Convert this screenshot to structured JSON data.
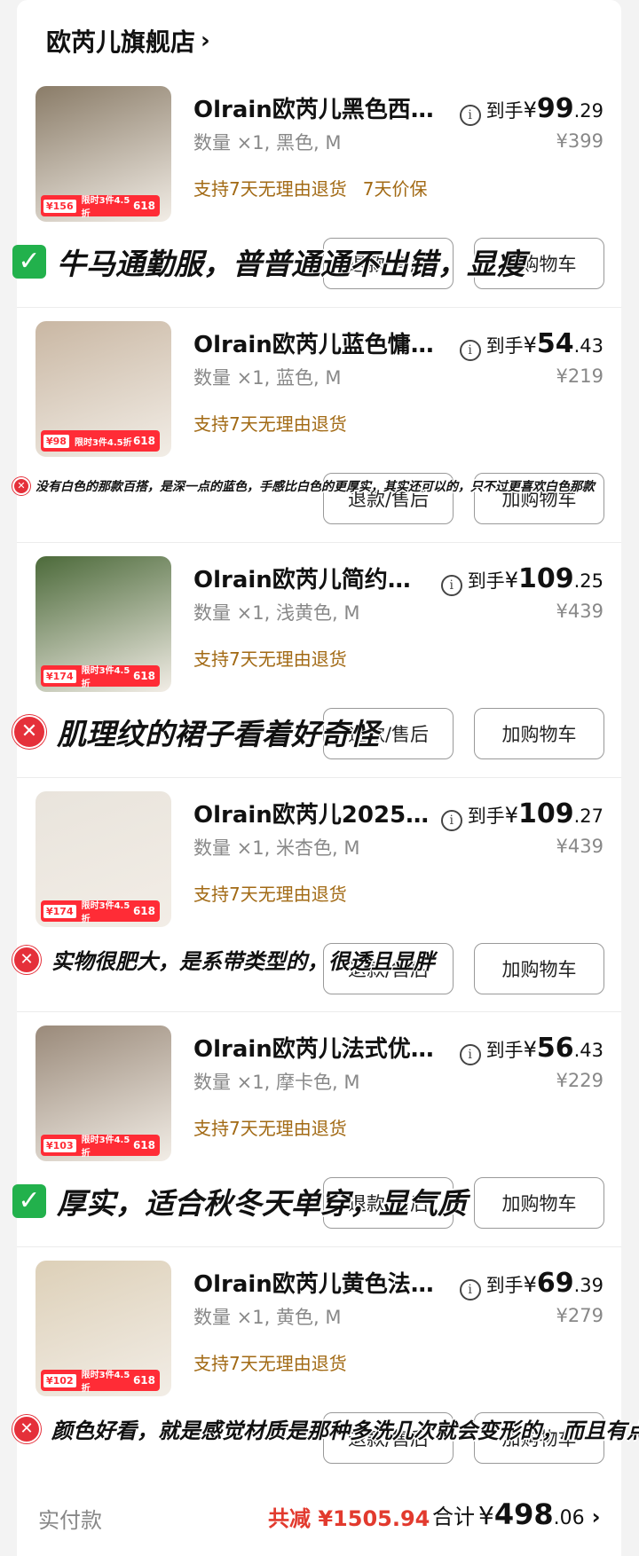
{
  "store": {
    "name": "欧芮儿旗舰店",
    "chevron": "›"
  },
  "items": [
    {
      "name": "Olrain欧芮儿黑色西…",
      "price_prefix": "到手",
      "currency": "¥",
      "price_int": "99",
      "price_dec": ".29",
      "spec": "数量 ×1, 黑色, M",
      "original_price": "¥399",
      "services": [
        "支持7天无理由退货",
        "7天价保"
      ],
      "promo_price": "¥156",
      "promo_text": "限时3件4.5折",
      "promo_badge": "618",
      "refund_label": "退款/售后",
      "cart_label": "加购物车",
      "comment": {
        "mark": "✓",
        "text": "牛马通勤服，普普通通不出错，显瘦"
      },
      "photo_color": "#8a7c68"
    },
    {
      "name": "Olrain欧芮儿蓝色慵…",
      "price_prefix": "到手",
      "currency": "¥",
      "price_int": "54",
      "price_dec": ".43",
      "spec": "数量 ×1, 蓝色, M",
      "original_price": "¥219",
      "services": [
        "支持7天无理由退货"
      ],
      "promo_price": "¥98",
      "promo_text": "限时3件4.5折",
      "promo_badge": "618",
      "refund_label": "退款/售后",
      "cart_label": "加购物车",
      "comment": {
        "mark": "✕",
        "text": "没有白色的那款百搭，是深一点的蓝色，手感比白色的更厚实，其实还可以的，只不过更喜欢白色那款"
      },
      "photo_color": "#c9b7a3"
    },
    {
      "name": "Olrain欧芮儿简约…",
      "price_prefix": "到手",
      "currency": "¥",
      "price_int": "109",
      "price_dec": ".25",
      "spec": "数量 ×1, 浅黄色, M",
      "original_price": "¥439",
      "services": [
        "支持7天无理由退货"
      ],
      "promo_price": "¥174",
      "promo_text": "限时3件4.5折",
      "promo_badge": "618",
      "refund_label": "退款/售后",
      "cart_label": "加购物车",
      "comment": {
        "mark": "✕",
        "text": "肌理纹的裙子看着好奇怪"
      },
      "photo_color": "#4c6a3a"
    },
    {
      "name": "Olrain欧芮儿2025…",
      "price_prefix": "到手",
      "currency": "¥",
      "price_int": "109",
      "price_dec": ".27",
      "spec": "数量 ×1, 米杏色, M",
      "original_price": "¥439",
      "services": [
        "支持7天无理由退货"
      ],
      "promo_price": "¥174",
      "promo_text": "限时3件4.5折",
      "promo_badge": "618",
      "refund_label": "退款/售后",
      "cart_label": "加购物车",
      "comment": {
        "mark": "✕",
        "text": "实物很肥大，是系带类型的，很透且显胖"
      },
      "photo_color": "#e9e4dc"
    },
    {
      "name": "Olrain欧芮儿法式优…",
      "price_prefix": "到手",
      "currency": "¥",
      "price_int": "56",
      "price_dec": ".43",
      "spec": "数量 ×1, 摩卡色, M",
      "original_price": "¥229",
      "services": [
        "支持7天无理由退货"
      ],
      "promo_price": "¥103",
      "promo_text": "限时3件4.5折",
      "promo_badge": "618",
      "refund_label": "退款/售后",
      "cart_label": "加购物车",
      "comment": {
        "mark": "✓",
        "text": "厚实，适合秋冬天单穿，显气质"
      },
      "photo_color": "#9a8a7a"
    },
    {
      "name": "Olrain欧芮儿黄色法…",
      "price_prefix": "到手",
      "currency": "¥",
      "price_int": "69",
      "price_dec": ".39",
      "spec": "数量 ×1, 黄色, M",
      "original_price": "¥279",
      "services": [
        "支持7天无理由退货"
      ],
      "promo_price": "¥102",
      "promo_text": "限时3件4.5折",
      "promo_badge": "618",
      "refund_label": "退款/售后",
      "cart_label": "加购物车",
      "comment": {
        "mark": "✕",
        "text": "颜色好看，就是感觉材质是那种多洗几次就会变形的，而且有点长"
      },
      "photo_color": "#ddd0b8"
    }
  ],
  "footer": {
    "paid_label": "实付款",
    "discount": "共减 ¥1505.94",
    "total_label": "合计",
    "currency": "¥",
    "total_int": "498",
    "total_dec": ".06",
    "chevron": "›"
  },
  "colors": {
    "accent_red": "#e23a2e",
    "service_brown": "#a26a15",
    "check_green": "#22b14c",
    "cross_red": "#e5303a"
  },
  "icons": {
    "info": "info-icon",
    "check": "check-icon",
    "cross": "cross-icon"
  }
}
